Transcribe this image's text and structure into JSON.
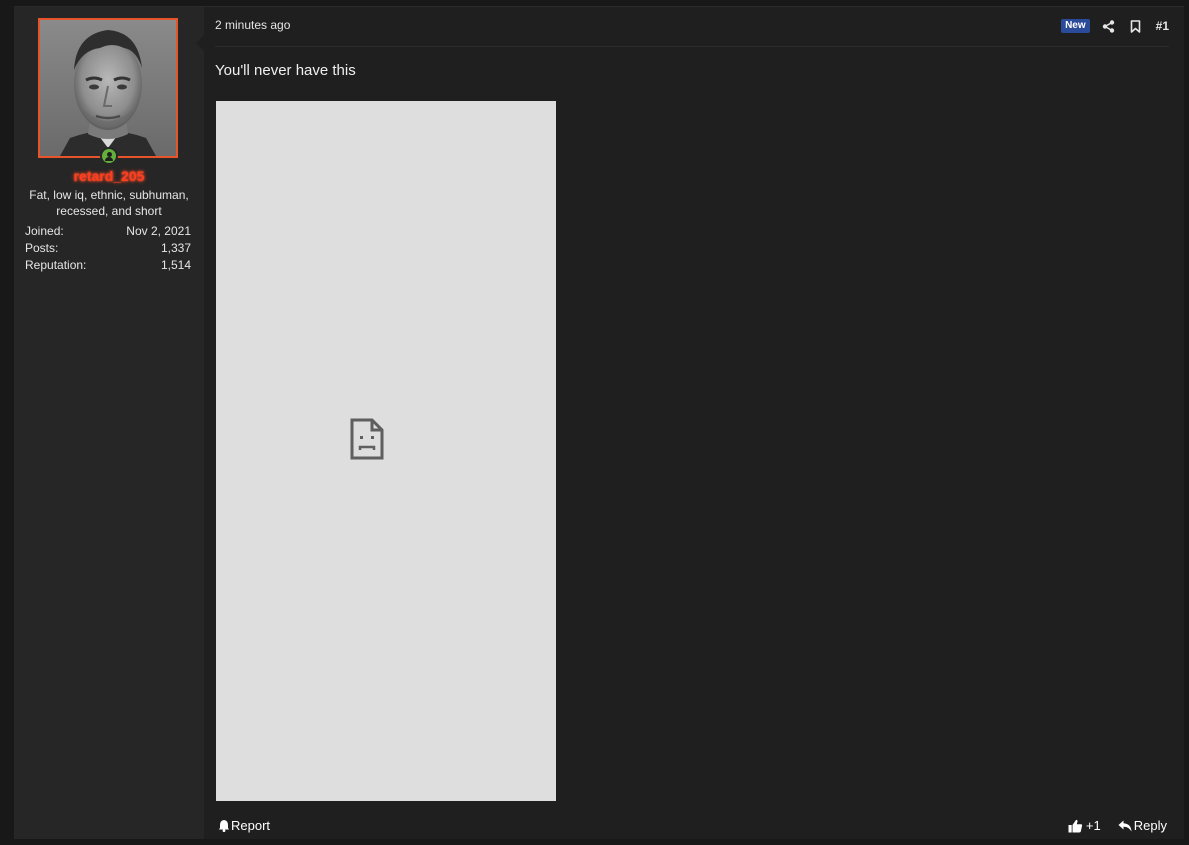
{
  "user": {
    "username": "retard_205",
    "title": "Fat, low iq, ethnic, subhuman, recessed, and short",
    "stats": [
      {
        "label": "Joined:",
        "value": "Nov 2, 2021"
      },
      {
        "label": "Posts:",
        "value": "1,337"
      },
      {
        "label": "Reputation:",
        "value": "1,514"
      }
    ],
    "online_icon": "user-online-icon",
    "username_color": "#ff3d1f",
    "avatar_border_color": "#e8542a"
  },
  "header": {
    "timestamp": "2 minutes ago",
    "badge": "New",
    "badge_color": "#2a4a9a",
    "share_icon": "share-icon",
    "bookmark_icon": "bookmark-icon",
    "post_number": "#1"
  },
  "message": {
    "text": "You'll never have this",
    "image_icon": "broken-image-icon"
  },
  "footer": {
    "report_label": "Report",
    "report_icon": "bell-icon",
    "like_label": "+1",
    "like_icon": "thumbs-up-icon",
    "reply_label": "Reply",
    "reply_icon": "reply-icon"
  }
}
